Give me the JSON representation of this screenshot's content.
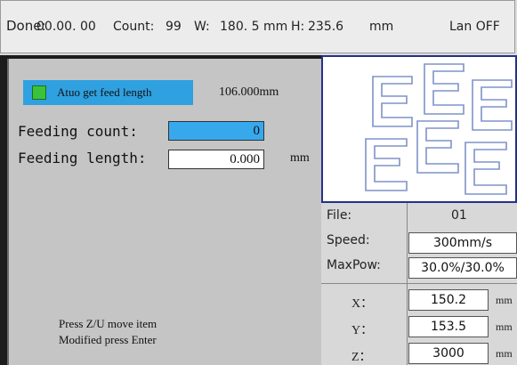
{
  "status_bar": {
    "done_label": "Done:",
    "done_value": "00.00. 00",
    "count_label": "Count:",
    "count_value": "99",
    "w_label": "W:",
    "w_value": "180. 5 mm",
    "h_label": "H:",
    "h_value": "235.6",
    "unit": "mm",
    "lan_status": "Lan OFF"
  },
  "feed_panel": {
    "auto_feed_label": "Atuo get feed length",
    "auto_feed_value": "106.000mm",
    "feeding_count_label": "Feeding count:",
    "feeding_count_value": "0",
    "feeding_length_label": "Feeding length:",
    "feeding_length_value": "0.000",
    "length_unit": "mm",
    "hint_line1": "Press Z/U move item",
    "hint_line2": "Modified press Enter"
  },
  "info_panel": {
    "file_label": "File:",
    "file_value": "01",
    "speed_label": "Speed:",
    "speed_value": "300mm/s",
    "maxpow_label": "MaxPow:",
    "maxpow_value": "30.0%/30.0%",
    "x_label": "X：",
    "x_value": "150.2",
    "x_unit": "mm",
    "y_label": "Y：",
    "y_value": "153.5",
    "y_unit": "mm",
    "z_label": "Z：",
    "z_value": "3000",
    "z_unit": "mm"
  },
  "colors": {
    "selected_field": "#37a8ec",
    "checkbox": "#3ac23a",
    "preview_border": "#25318a",
    "preview_stroke": "#7f93c8"
  }
}
